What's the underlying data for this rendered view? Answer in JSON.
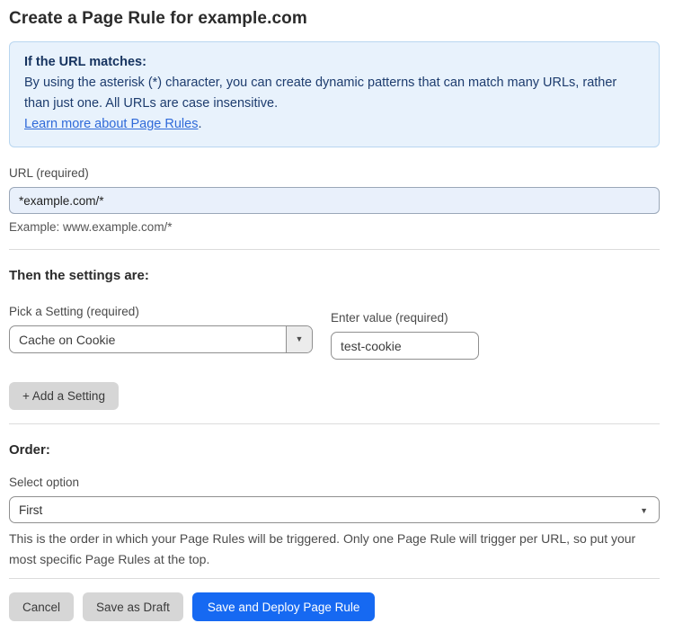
{
  "page": {
    "title": "Create a Page Rule for example.com"
  },
  "info_box": {
    "heading": "If the URL matches:",
    "body": "By using the asterisk (*) character, you can create dynamic patterns that can match many URLs, rather than just one. All URLs are case insensitive.",
    "link_label": "Learn more about Page Rules",
    "link_suffix": "."
  },
  "url_field": {
    "label": "URL (required)",
    "value": "*example.com/*",
    "example": "Example: www.example.com/*"
  },
  "settings_section": {
    "heading": "Then the settings are:",
    "setting_label": "Pick a Setting (required)",
    "setting_value": "Cache on Cookie",
    "value_label": "Enter value (required)",
    "value_value": "test-cookie",
    "add_button_label": "+ Add a Setting"
  },
  "order_section": {
    "heading": "Order:",
    "select_label": "Select option",
    "selected_option": "First",
    "help_text": "This is the order in which your Page Rules will be triggered. Only one Page Rule will trigger per URL, so put your most specific Page Rules at the top."
  },
  "footer": {
    "cancel_label": "Cancel",
    "save_draft_label": "Save as Draft",
    "save_deploy_label": "Save and Deploy Page Rule"
  },
  "icons": {
    "dropdown_arrow": "▼"
  },
  "colors": {
    "info_bg": "#e8f2fc",
    "info_border": "#b9d6f0",
    "info_text": "#1d3c6e",
    "link": "#2f6ad9",
    "url_input_bg": "#e9f0fb",
    "primary_button": "#1669f2",
    "gray_button": "#d6d6d6"
  }
}
